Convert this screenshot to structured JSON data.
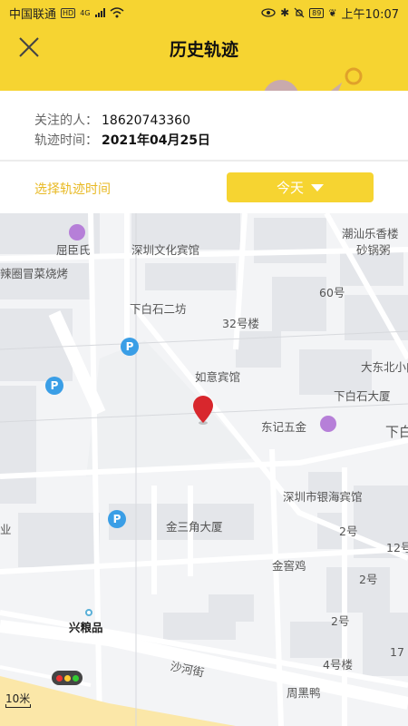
{
  "status_bar": {
    "carrier": "中国联通",
    "hd": "HD",
    "network": "4G",
    "battery": "89",
    "time": "上午10:07"
  },
  "header": {
    "title": "历史轨迹"
  },
  "info": {
    "person_label": "关注的人：",
    "person_value": "18620743360",
    "date_label": "轨迹时间：",
    "date_value": "2021年04月25日"
  },
  "time_select": {
    "label": "选择轨迹时间",
    "button": "今天"
  },
  "map": {
    "labels": {
      "quchenshi": "屈臣氏",
      "shenzhen_wenhua": "深圳文化宾馆",
      "chaoshan": "潮汕乐香楼",
      "shaguo": "砂锅粥",
      "lachao": "辣圈冒菜烧烤",
      "no60": "60号",
      "xiabaishi2": "下白石二坊",
      "no32": "32号楼",
      "dadongbei": "大东北小肉串",
      "ruyi": "如意宾馆",
      "xiabaishi_da": "下白石大厦",
      "dongji": "东记五金",
      "xia": "下白",
      "yinhai": "深圳市银海宾馆",
      "jinsanjiao": "金三角大厦",
      "ye": "业",
      "no2a": "2号",
      "no12": "12号",
      "jinyaoji": "金窖鸡",
      "no2b": "2号",
      "no2c": "2号",
      "xingliangpin": "兴粮品",
      "no17": "17",
      "no4": "4号楼",
      "shahe": "沙河街",
      "zhouheiya": "周黑鸭"
    },
    "scale": "10米"
  }
}
